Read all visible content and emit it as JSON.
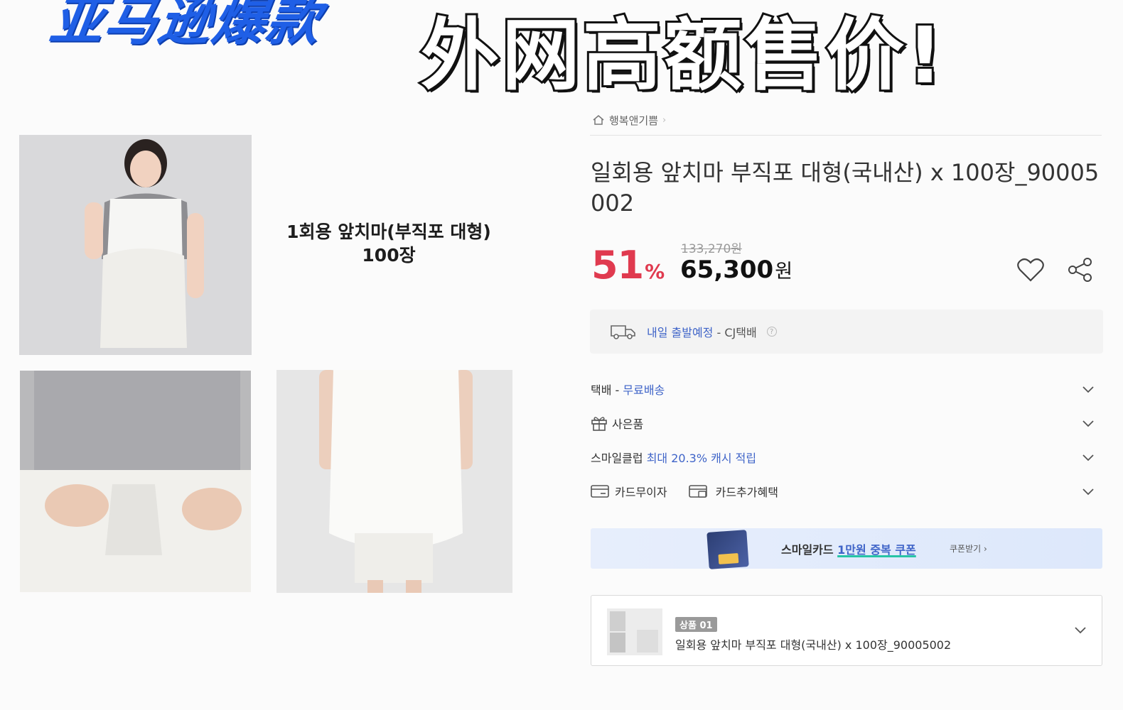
{
  "overlay": {
    "left_heading": "亚马逊爆款",
    "right_heading": "外网高额售价!"
  },
  "gallery": {
    "caption_line1": "1회용 앞치마(부직포 대형)",
    "caption_line2": "100장"
  },
  "product": {
    "breadcrumb": "행복앤기쁨",
    "title": "일회용 앞치마 부직포 대형(국내산) x 100장_90005002",
    "discount_value": "51",
    "discount_unit": "%",
    "original_price": "133,270원",
    "sale_price": "65,300",
    "currency": "원"
  },
  "shipping": {
    "schedule": "내일 출발예정",
    "carrier": "- CJ택배",
    "help": "?"
  },
  "options": {
    "delivery_label": "택배 - ",
    "delivery_value": "무료배송",
    "gift_label": "사은품",
    "club_label": "스마일클럽 ",
    "club_value": "최대 20.3% 캐시 적립",
    "card_installment": "카드무이자",
    "card_benefit": "카드추가혜택"
  },
  "banner": {
    "text_prefix": "스마일카드 ",
    "text_highlight": "1만원 중복 쿠폰",
    "link": "쿠폰받기 ›"
  },
  "selection": {
    "badge": "상품 01",
    "title": "일회용 앞치마 부직포 대형(국내산) x 100장_90005002"
  },
  "colors": {
    "discount": "#e03a4f",
    "link_blue": "#3f64c8",
    "heading_blue": "#1f5fe6"
  }
}
